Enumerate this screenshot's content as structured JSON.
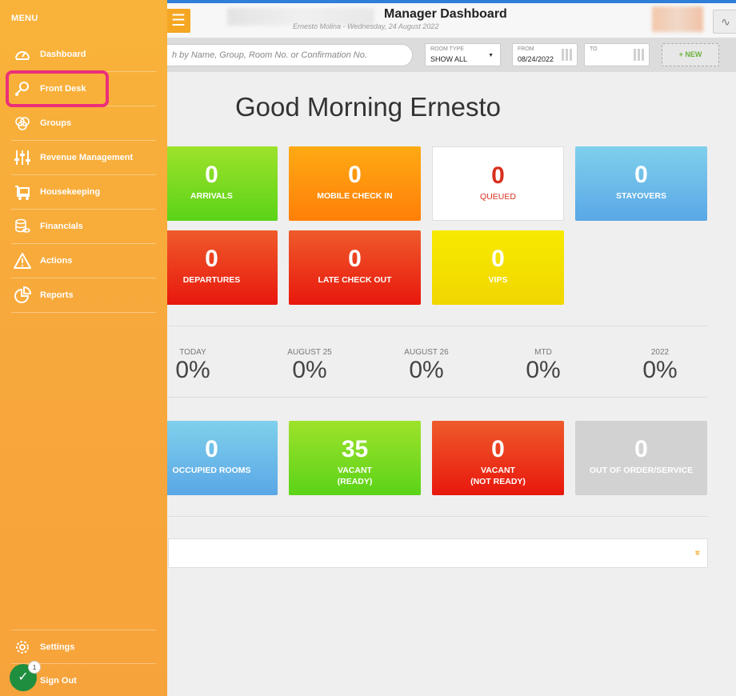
{
  "header": {
    "title": "Manager Dashboard",
    "subtitle": "Ernesto Molina - Wednesday, 24 August 2022",
    "menu_glyph": "☰",
    "pulse_glyph": "∿"
  },
  "toolbar": {
    "search_placeholder": "h by Name, Group, Room No. or Confirmation No.",
    "room_type_label": "ROOM TYPE",
    "room_type_value": "SHOW ALL",
    "from_label": "FROM",
    "from_value": "08/24/2022",
    "to_label": "TO",
    "to_value": "",
    "new_label": "+ NEW"
  },
  "greeting": "Good Morning Ernesto",
  "tiles_top": [
    {
      "value": "0",
      "label": "ARRIVALS"
    },
    {
      "value": "0",
      "label": "MOBILE CHECK IN"
    },
    {
      "value": "0",
      "label": "QUEUED"
    },
    {
      "value": "0",
      "label": "STAYOVERS"
    },
    {
      "value": "0",
      "label": "DEPARTURES"
    },
    {
      "value": "0",
      "label": "LATE CHECK OUT"
    },
    {
      "value": "0",
      "label": "VIPS"
    }
  ],
  "stats": [
    {
      "label": "TODAY",
      "value": "0%"
    },
    {
      "label": "AUGUST 25",
      "value": "0%"
    },
    {
      "label": "AUGUST 26",
      "value": "0%"
    },
    {
      "label": "MTD",
      "value": "0%"
    },
    {
      "label": "2022",
      "value": "0%"
    }
  ],
  "tiles_rooms": [
    {
      "value": "0",
      "label": "OCCUPIED ROOMS",
      "label2": ""
    },
    {
      "value": "35",
      "label": "VACANT",
      "label2": "(READY)"
    },
    {
      "value": "0",
      "label": "VACANT",
      "label2": "(NOT READY)"
    },
    {
      "value": "0",
      "label": "OUT OF ORDER/SERVICE",
      "label2": ""
    }
  ],
  "expander_glyph": "»",
  "sidebar": {
    "title": "MENU",
    "items": [
      {
        "label": "Dashboard",
        "icon": "gauge-icon"
      },
      {
        "label": "Front Desk",
        "icon": "bell-key-icon"
      },
      {
        "label": "Groups",
        "icon": "circles-icon"
      },
      {
        "label": "Revenue Management",
        "icon": "sliders-icon"
      },
      {
        "label": "Housekeeping",
        "icon": "cart-icon"
      },
      {
        "label": "Financials",
        "icon": "coins-icon"
      },
      {
        "label": "Actions",
        "icon": "warning-icon"
      },
      {
        "label": "Reports",
        "icon": "pie-chart-icon"
      }
    ],
    "settings_label": "Settings",
    "signout_label": "Sign Out",
    "badge_count": "1",
    "check_glyph": "✓"
  }
}
